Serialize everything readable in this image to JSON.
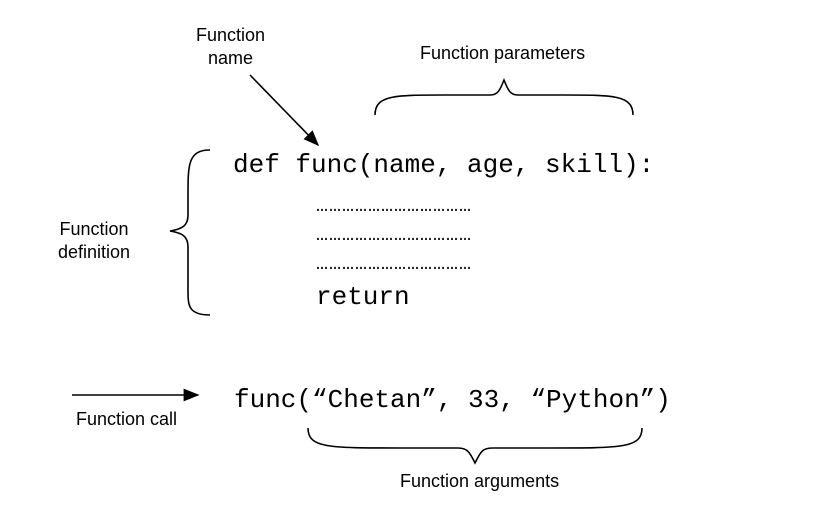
{
  "labels": {
    "function_name": "Function\nname",
    "function_parameters": "Function parameters",
    "function_definition": "Function\ndefinition",
    "function_call": "Function call",
    "function_arguments": "Function arguments"
  },
  "code": {
    "def_line": "def func(name, age, skill):",
    "body_dots_1": "………………………………",
    "body_dots_2": "………………………………",
    "body_dots_3": "………………………………",
    "return_stmt": "return",
    "call_line": "func(“Chetan”, 33, “Python”)"
  }
}
